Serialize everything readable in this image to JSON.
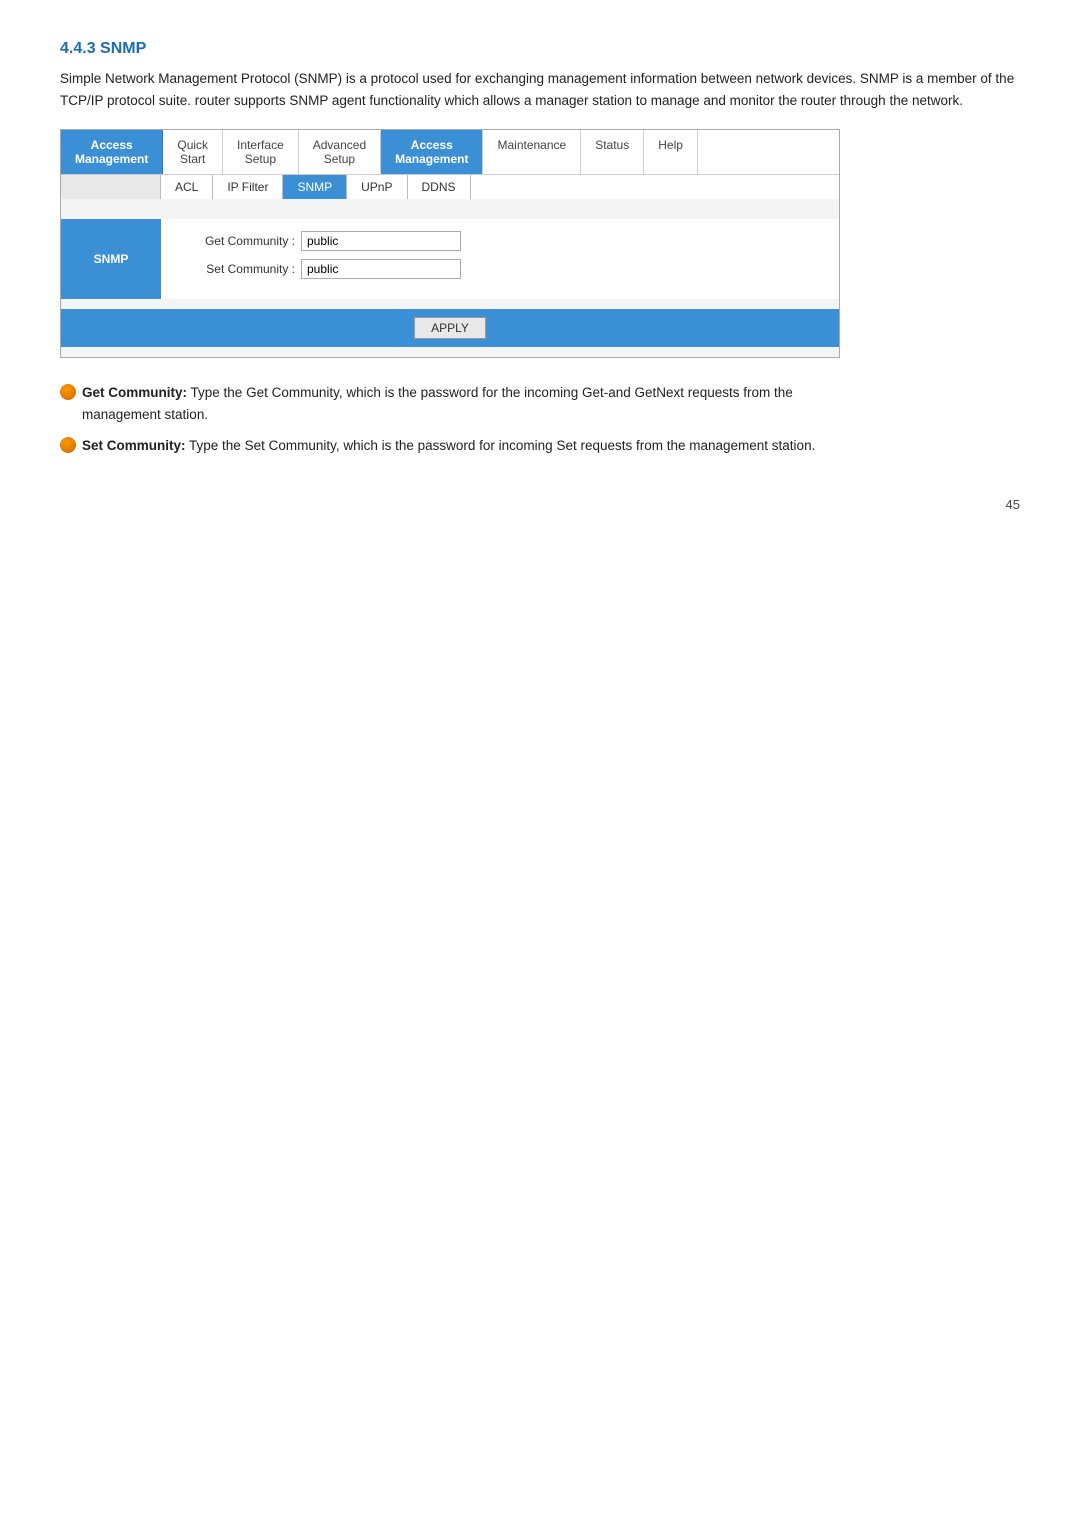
{
  "page": {
    "title": "4.4.3 SNMP",
    "intro": "Simple Network Management Protocol (SNMP) is a protocol used for exchanging management information between network devices. SNMP is a member of the TCP/IP protocol suite. router supports SNMP agent functionality which allows a manager station to manage and monitor the router through the network.",
    "page_number": "45"
  },
  "nav": {
    "side_label_line1": "Access",
    "side_label_line2": "Management",
    "items": [
      {
        "label": "Quick\nStart",
        "active": false
      },
      {
        "label": "Interface\nSetup",
        "active": false
      },
      {
        "label": "Advanced\nSetup",
        "active": false
      },
      {
        "label": "Access\nManagement",
        "active": true
      },
      {
        "label": "Maintenance",
        "active": false
      },
      {
        "label": "Status",
        "active": false
      },
      {
        "label": "Help",
        "active": false
      }
    ],
    "sub_items": [
      {
        "label": "ACL",
        "active": false
      },
      {
        "label": "IP Filter",
        "active": false
      },
      {
        "label": "SNMP",
        "active": true
      },
      {
        "label": "UPnP",
        "active": false
      },
      {
        "label": "DDNS",
        "active": false
      }
    ]
  },
  "snmp": {
    "section_label": "SNMP",
    "get_community_label": "Get Community :",
    "get_community_value": "public",
    "set_community_label": "Set Community :",
    "set_community_value": "public",
    "apply_button": "APPLY"
  },
  "descriptions": [
    {
      "key": "get-community-desc",
      "term": "Get Community:",
      "text": " Type the Get Community, which is the password for the incoming Get-and GetNext requests from the management station."
    },
    {
      "key": "set-community-desc",
      "term": "Set Community:",
      "text": " Type the Set Community, which is the password for incoming Set requests from the management station."
    }
  ]
}
